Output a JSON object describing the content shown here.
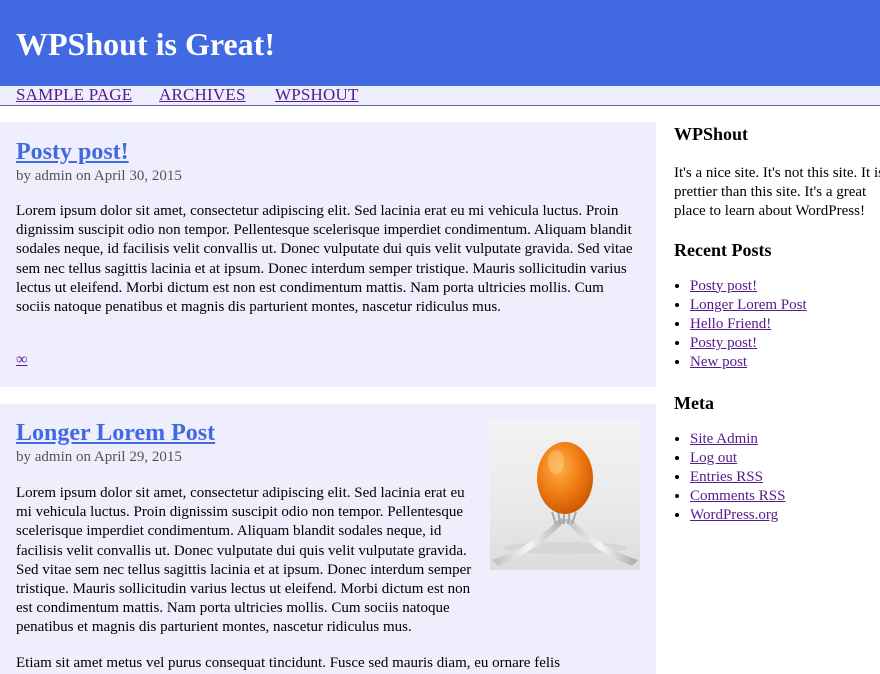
{
  "header": {
    "site_title": "WPShout is Great!",
    "background": "#4169e1"
  },
  "nav": {
    "items": [
      {
        "label": "SAMPLE PAGE"
      },
      {
        "label": "ARCHIVES"
      },
      {
        "label": "WPSHOUT"
      }
    ]
  },
  "posts": [
    {
      "title": "Posty post!",
      "byline": "by admin on April 30, 2015",
      "excerpt": "Lorem ipsum dolor sit amet, consectetur adipiscing elit. Sed lacinia erat eu mi vehicula luctus. Proin dignissim suscipit odio non tempor. Pellentesque scelerisque imperdiet condimentum. Aliquam blandit sodales neque, id facilisis velit convallis ut. Donec vulputate dui quis velit vulputate gravida. Sed vitae sem nec tellus sagittis lacinia et at ipsum. Donec interdum semper tristique. Mauris sollicitudin varius lectus ut eleifend. Morbi dictum est non est condimentum mattis. Nam porta ultricies mollis. Cum sociis natoque penatibus et magnis dis parturient montes, nascetur ridiculus mus.",
      "permalink": "∞"
    },
    {
      "title": "Longer Lorem Post",
      "byline": "by admin on April 29, 2015",
      "excerpt": "Lorem ipsum dolor sit amet, consectetur adipiscing elit. Sed lacinia erat eu mi vehicula luctus. Proin dignissim suscipit odio non tempor. Pellentesque scelerisque imperdiet condimentum. Aliquam blandit sodales neque, id facilisis velit convallis ut. Donec vulputate dui quis velit vulputate gravida. Sed vitae sem nec tellus sagittis lacinia et at ipsum. Donec interdum semper tristique. Mauris sollicitudin varius lectus ut eleifend. Morbi dictum est non est condimentum mattis. Nam porta ultricies mollis. Cum sociis natoque penatibus et magnis dis parturient montes, nascetur ridiculus mus.",
      "excerpt_more": "Etiam sit amet metus vel purus consequat tincidunt. Fusce sed mauris diam, eu ornare felis",
      "thumbnail_icon": "egg-on-forks-image"
    }
  ],
  "sidebar": {
    "about": {
      "title": "WPShout",
      "text": "It's a nice site. It's not this site. It is prettier than this site. It's a great place to learn about WordPress!"
    },
    "recent_posts": {
      "title": "Recent Posts",
      "items": [
        "Posty post!",
        "Longer Lorem Post",
        "Hello Friend!",
        "Posty post!",
        "New post"
      ]
    },
    "meta": {
      "title": "Meta",
      "items": [
        "Site Admin",
        "Log out",
        "Entries RSS",
        "Comments RSS",
        "WordPress.org"
      ]
    }
  },
  "colors": {
    "accent": "#4169e1",
    "post_bg": "#eeeefd",
    "visited_link": "#551a8b"
  }
}
